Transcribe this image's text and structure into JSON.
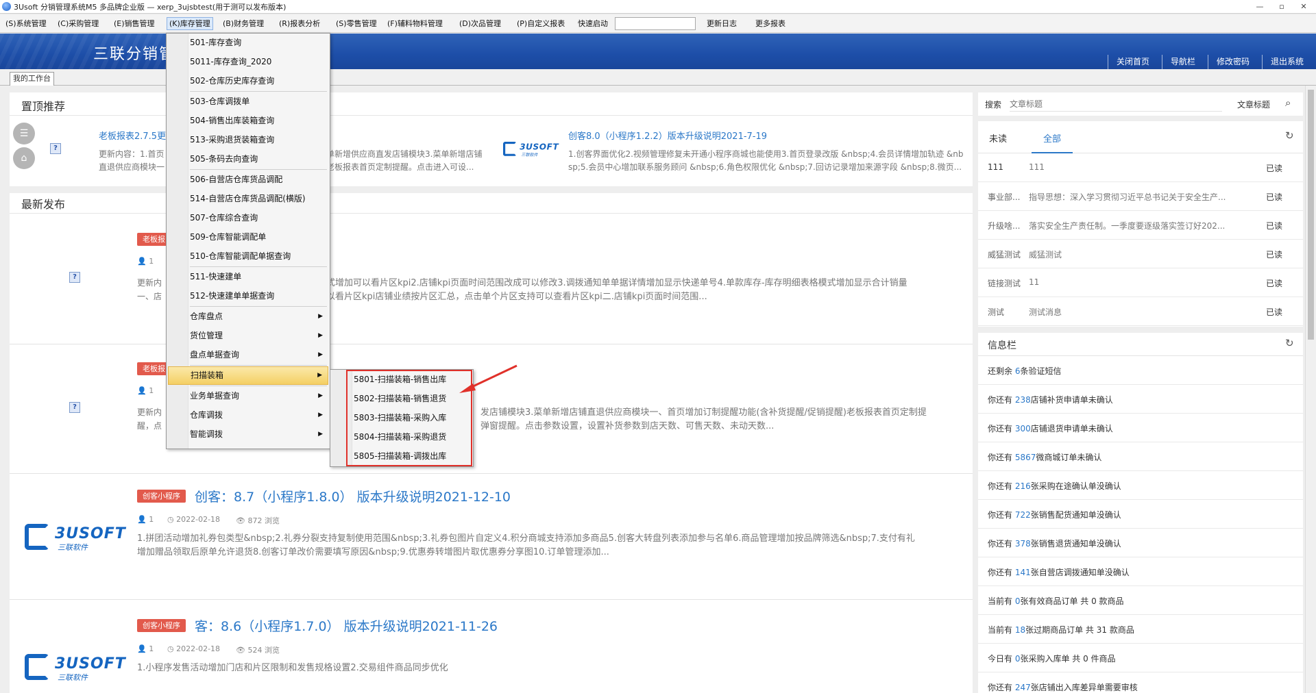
{
  "window": {
    "title": "3Usoft 分销管理系统M5 多品牌企业版 — xerp_3ujsbtest(用于测可以发布版本)",
    "controls": [
      "—",
      "▫",
      "✕"
    ]
  },
  "menubar": {
    "items": [
      "(S)系统管理",
      "(C)采购管理",
      "(E)销售管理",
      "(K)库存管理",
      "(B)财务管理",
      "(R)报表分析",
      "(S)零售管理",
      "(F)辅料物料管理",
      "(D)次品管理",
      "(P)自定义报表"
    ],
    "quick_label": "快速启动",
    "quick_value": "",
    "update_log": "更新日志",
    "more_reports": "更多报表"
  },
  "banner": {
    "title": "三联分销管理",
    "links": [
      "关闭首页",
      "导航栏",
      "修改密码",
      "退出系统"
    ]
  },
  "tabs": [
    "我的工作台"
  ],
  "pinned": {
    "title": "置顶推荐",
    "item1": {
      "title": "老板报表2.7.5更",
      "desc1": "更新内容：1.首页",
      "desc2": "直退供应商模块一",
      "desc_right1": "单新增供应商直发店铺模块3.菜单新增店铺",
      "desc_right2": "老板报表首页定制提醒。点击进入可设..."
    },
    "item2": {
      "title": "创客8.0（小程序1.2.2）版本升级说明2021-7-19",
      "desc1": "1.创客界面优化2.视频管理修复未开通小程序商城也能使用3.首页登录改版 &nbsp;4.会员详情增加轨迹 &nb",
      "desc2": "sp;5.会员中心增加联系服务顾问 &nbsp;6.角色权限优化 &nbsp;7.回访记录增加来源字段 &nbsp;8.微页..."
    }
  },
  "latest": {
    "title": "最新发布",
    "item1": {
      "badge": "老板报",
      "meta_user": "1",
      "desc_left1": "更新内",
      "desc_left2": "一、店",
      "desc1": "式增加可以看片区kpi2.店铺kpi页面时间范围改成可以修改3.调拨通知单单据详情增加显示快递单号4.单款库存-库存明细表格模式增加显示合计销量",
      "desc2": "以看片区kpi店铺业绩按片区汇总，点击单个片区支持可以查看片区kpi二.店铺kpi页面时间范围..."
    },
    "item2": {
      "badge": "老板报",
      "meta_user": "1",
      "desc_left1": "更新内",
      "desc_left2": "醒，点",
      "desc1": "发店铺模块3.菜单新增店铺直退供应商模块一、首页增加订制提醒功能(含补货提醒/促销提醒)老板报表首页定制提",
      "desc2": "弹窗提醒。点击参数设置，设置补货参数到店天数、可售天数、未动天数..."
    },
    "item3": {
      "badge": "创客小程序",
      "title": "创客：8.7（小程序1.8.0） 版本升级说明2021-12-10",
      "meta_user": "1",
      "meta_date": "2022-02-18",
      "meta_views": "872 浏览",
      "desc1": "1.拼团活动增加礼券包类型&nbsp;2.礼券分裂支持复制使用范围&nbsp;3.礼券包图片自定义4.积分商城支持添加多商品5.创客大转盘列表添加参与名单6.商品管理增加按品牌筛选&nbsp;7.支付有礼",
      "desc2": "增加赠品领取后原单允许退货8.创客订单改价需要填写原因&nbsp;9.优惠券转增图片取优惠券分享图10.订单管理添加..."
    },
    "item4": {
      "badge": "创客小程序",
      "title": "客：8.6（小程序1.7.0） 版本升级说明2021-11-26",
      "meta_user": "1",
      "meta_date": "2022-02-18",
      "meta_views": "524 浏览",
      "desc1": "1.小程序发售活动增加门店和片区限制和发售规格设置2.交易组件商品同步优化"
    },
    "logo_brand": "3USOFT",
    "logo_sub": "三联软件"
  },
  "search": {
    "label": "搜索",
    "placeholder": "文章标题",
    "type_label": "文章标题"
  },
  "messages": {
    "tabs": [
      "未读",
      "全部"
    ],
    "rows": [
      {
        "from": "111",
        "text": "111",
        "status": "已读"
      },
      {
        "from": "事业部...",
        "text": "指导思想：深入学习贯彻习近平总书记关于安全生产...",
        "status": "已读"
      },
      {
        "from": "升级啥...",
        "text": "落实安全生产责任制。一季度要逐级落实签订好202...",
        "status": "已读"
      },
      {
        "from": "威猛测试",
        "text": "威猛测试",
        "status": "已读"
      },
      {
        "from": "链接测试",
        "text": "11",
        "status": "已读"
      },
      {
        "from": "测试",
        "text": "测试消息",
        "status": "已读"
      }
    ]
  },
  "info": {
    "title": "信息栏",
    "rows": [
      {
        "pre": "还剩余 ",
        "num": "6",
        "post": "条验证短信"
      },
      {
        "pre": "你还有 ",
        "num": "238",
        "post": "店铺补货申请单未确认"
      },
      {
        "pre": "你还有 ",
        "num": "300",
        "post": "店铺退货申请单未确认"
      },
      {
        "pre": "你还有 ",
        "num": "5867",
        "post": "微商城订单未确认"
      },
      {
        "pre": "你还有 ",
        "num": "216",
        "post": "张采购在途确认单没确认"
      },
      {
        "pre": "你还有 ",
        "num": "722",
        "post": "张销售配货通知单没确认"
      },
      {
        "pre": "你还有 ",
        "num": "378",
        "post": "张销售退货通知单没确认"
      },
      {
        "pre": "你还有 ",
        "num": "141",
        "post": "张自营店调拨通知单没确认"
      },
      {
        "pre": "当前有 ",
        "num": "0",
        "post": "张有效商品订单 共 0 款商品"
      },
      {
        "pre": "当前有 ",
        "num": "18",
        "post": "张过期商品订单 共 31 款商品"
      },
      {
        "pre": "今日有 ",
        "num": "0",
        "post": "张采购入库单 共 0 件商品"
      },
      {
        "pre": "你还有 ",
        "num": "247",
        "post": "张店铺出入库差异单需要审核"
      }
    ]
  },
  "inventory_menu": {
    "items": [
      "501-库存查询",
      "5011-库存查询_2020",
      "502-仓库历史库存查询",
      "503-仓库调拨单",
      "504-销售出库装箱查询",
      "513-采购退货装箱查询",
      "505-条码去向查询",
      "506-自营店仓库货品调配",
      "514-自营店仓库货品调配(横版)",
      "507-仓库综合查询",
      "509-仓库智能调配单",
      "510-仓库智能调配单据查询",
      "511-快速建单",
      "512-快速建单单据查询",
      "仓库盘点",
      "货位管理",
      "盘点单据查询",
      "扫描装箱",
      "业务单据查询",
      "仓库调拨",
      "智能调拨"
    ]
  },
  "scan_submenu": {
    "items": [
      "5801-扫描装箱-销售出库",
      "5802-扫描装箱-销售退货",
      "5803-扫描装箱-采购入库",
      "5804-扫描装箱-采购退货",
      "5805-扫描装箱-调拨出库"
    ]
  },
  "colors": {
    "banner": "#1d4ea8",
    "link": "#2b78c8",
    "badge": "#e25a4c",
    "highlight": "#e0312a"
  }
}
